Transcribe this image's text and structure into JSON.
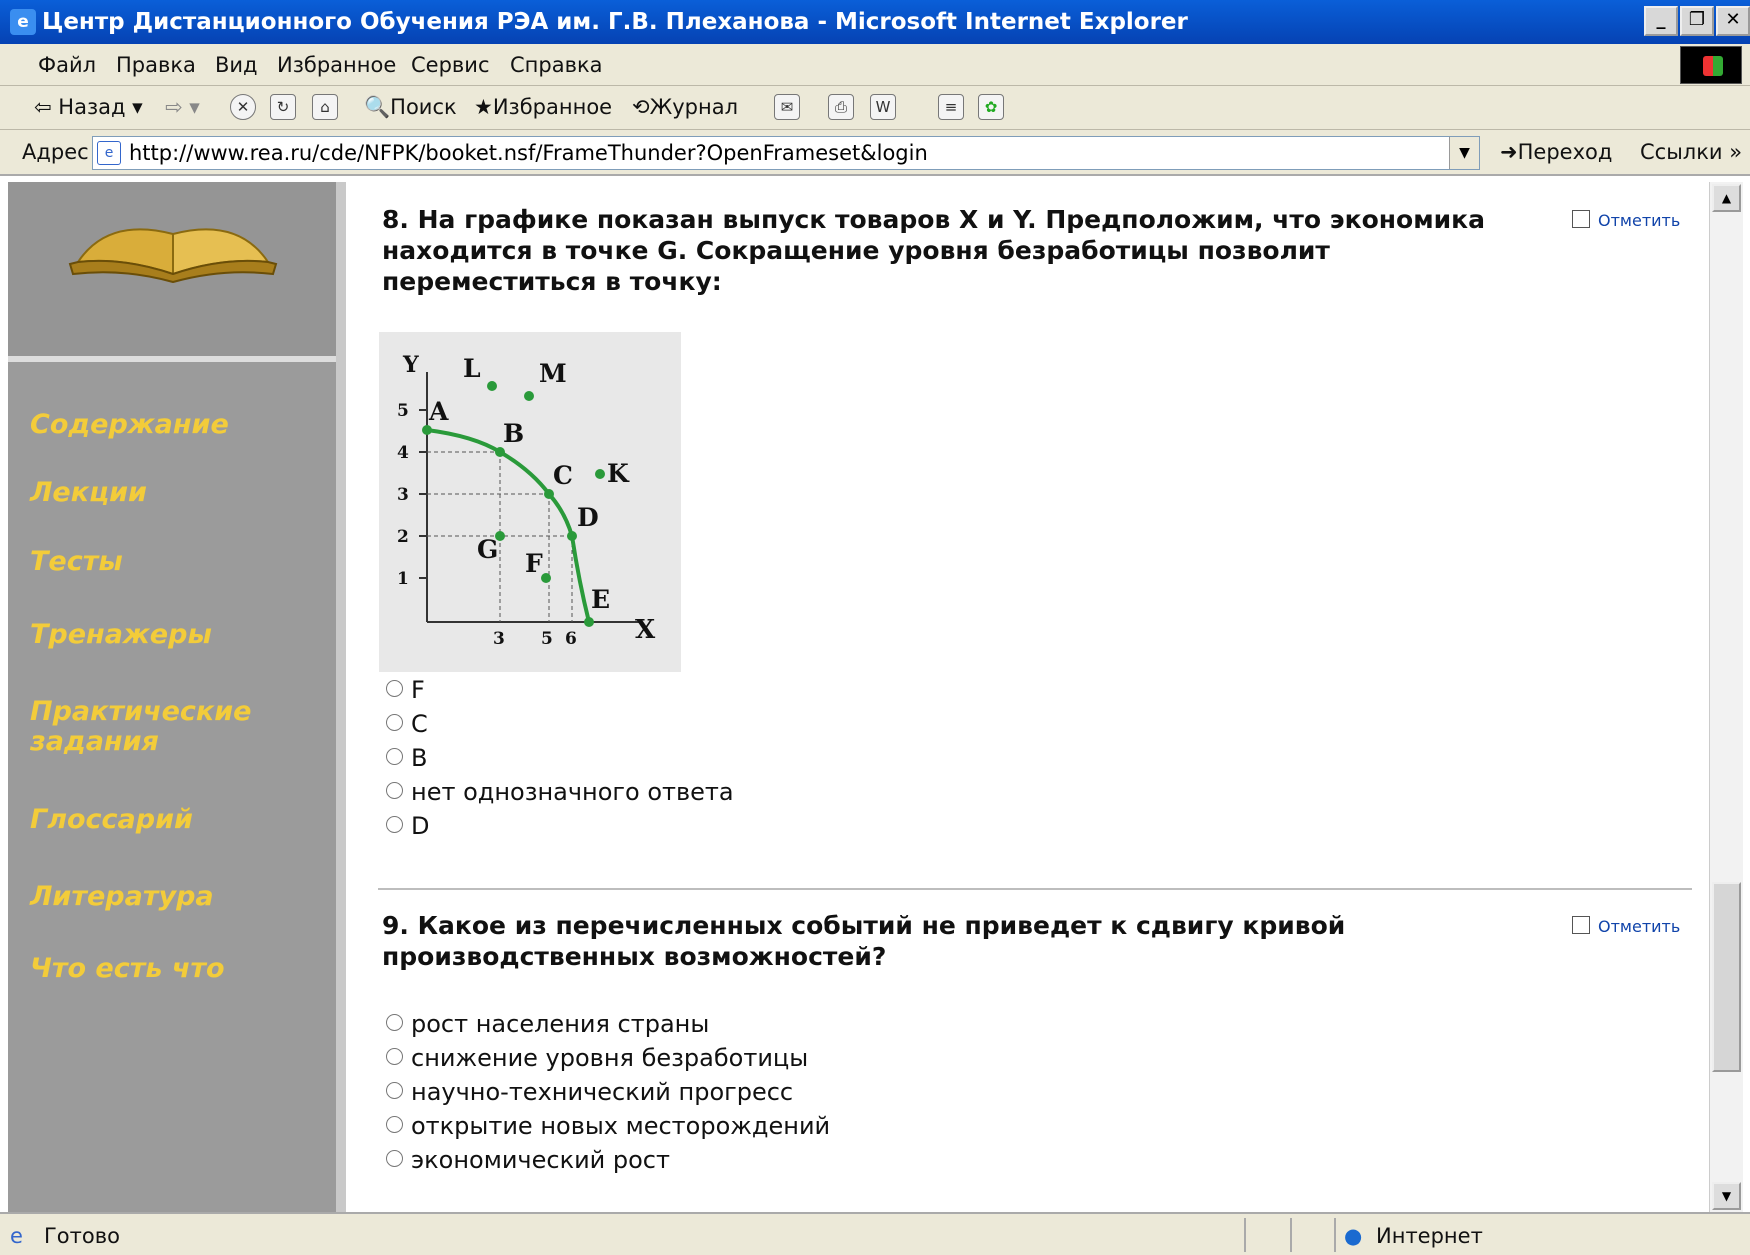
{
  "window": {
    "title": "Центр Дистанционного Обучения РЭА им. Г.В. Плеханова - Microsoft Internet Explorer"
  },
  "menu": [
    "Файл",
    "Правка",
    "Вид",
    "Избранное",
    "Сервис",
    "Справка"
  ],
  "toolbar": {
    "back": "Назад",
    "search": "Поиск",
    "favorites": "Избранное",
    "history": "Журнал"
  },
  "address": {
    "label": "Адрес",
    "url": "http://www.rea.ru/cde/NFPK/booket.nsf/FrameThunder?OpenFrameset&login",
    "go": "Переход",
    "links": "Ссылки"
  },
  "sidebar": {
    "items": [
      "Содержание",
      "Лекции",
      "Тесты",
      "Тренажеры",
      "Практические задания",
      "Глоссарий",
      "Литература",
      "Что есть что"
    ]
  },
  "questions": [
    {
      "text": "8. На графике показан выпуск товаров X и Y. Предположим, что экономика находится в точке G. Сокращение уровня безработицы позволит переместиться в точку:",
      "mark": "Отметить",
      "options": [
        "F",
        "C",
        "B",
        "нет однозначного ответа",
        "D"
      ]
    },
    {
      "text": "9. Какое из перечисленных событий не приведет к сдвигу кривой производственных возможностей?",
      "mark": "Отметить",
      "options": [
        "рост населения страны",
        "снижение уровня безработицы",
        "научно-технический прогресс",
        "открытие новых месторождений",
        "экономический рост"
      ]
    }
  ],
  "chart": {
    "ylabel": "Y",
    "xlabel": "X",
    "yticks": [
      "5",
      "4",
      "3",
      "2",
      "1"
    ],
    "xticks": [
      "3",
      "5",
      "6"
    ],
    "curve_points": {
      "A": [
        0,
        4.6
      ],
      "B": [
        3,
        4
      ],
      "C": [
        5,
        3
      ],
      "D": [
        6,
        2
      ],
      "E": [
        6.7,
        0
      ]
    },
    "other_points": {
      "L": [
        2.6,
        5.6
      ],
      "M": [
        4.2,
        5.4
      ],
      "K": [
        7.3,
        3.4
      ],
      "G": [
        3,
        2
      ],
      "F": [
        5,
        1
      ]
    }
  },
  "status": {
    "text": "Готово",
    "zone": "Интернет"
  }
}
